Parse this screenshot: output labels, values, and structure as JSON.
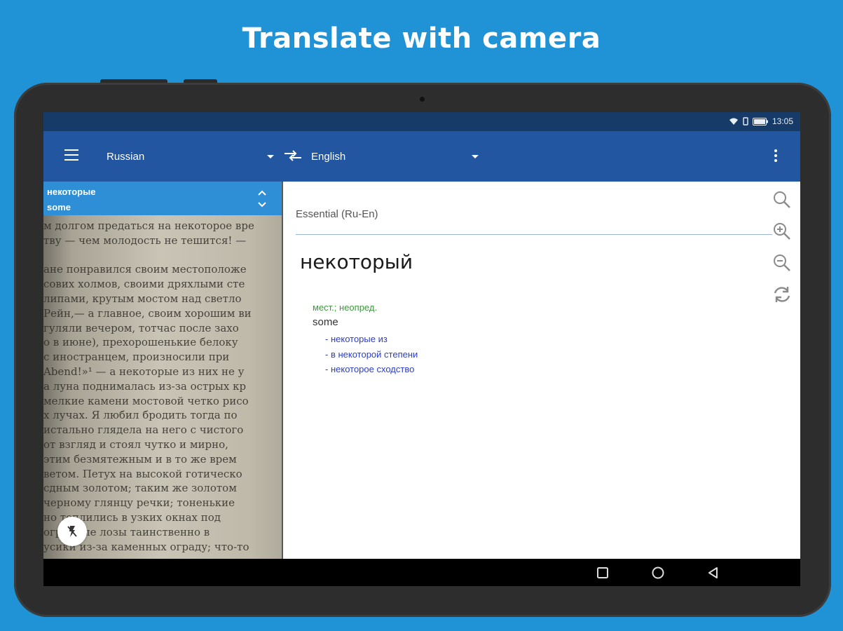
{
  "banner": {
    "title": "Translate with camera"
  },
  "status": {
    "time": "13:05"
  },
  "toolbar": {
    "source_language": "Russian",
    "target_language": "English"
  },
  "camera": {
    "selected_word": "некоторые",
    "selected_translation": "some",
    "text_lines": [
      "м долгом предаться на некоторое вре",
      "тву — чем молодость не тешится! —",
      "",
      "ане понравился своим местоположе",
      "сових холмов, своими дряхлыми сте",
      "липами, крутым мостом над светло",
      "Рейн,— а главное, своим хорошим ви",
      "гуляли вечером, тотчас после захо",
      "о в июне), прехорошенькие белоку",
      "с иностранцем, произносили при",
      "Abend!»¹ — а некоторые из них не у",
      "а луна поднималась из-за острых кр",
      "мелкие камени мостовой четко рисо",
      "х лучах. Я любил бродить тогда по",
      "истально глядела на него с чистого",
      "от взгляд и стоял чутко и мирно,",
      "этим безмятежным и в то же врем",
      "ветом. Петух на высокой готическо",
      "сдным золотом; таким же золотом",
      "черному глянцу речки; тоненькие",
      "но теплились в узких окнах под",
      "оградные лозы таинственно в",
      "усики из-за каменных ограду; что-то"
    ]
  },
  "dictionary": {
    "name": "Essential (Ru-En)",
    "headword": "некоторый",
    "grammar": "мест.; неопред.",
    "translation": "some",
    "examples": [
      "некоторые из",
      "в некоторой степени",
      "некоторое сходство"
    ]
  },
  "colors": {
    "background": "#1f93d6",
    "appbar": "#2256a1",
    "statusbar": "#173b68",
    "selection": "#2e8fd6",
    "grammar": "#3a9a3a",
    "example_link": "#2c3ec6"
  }
}
